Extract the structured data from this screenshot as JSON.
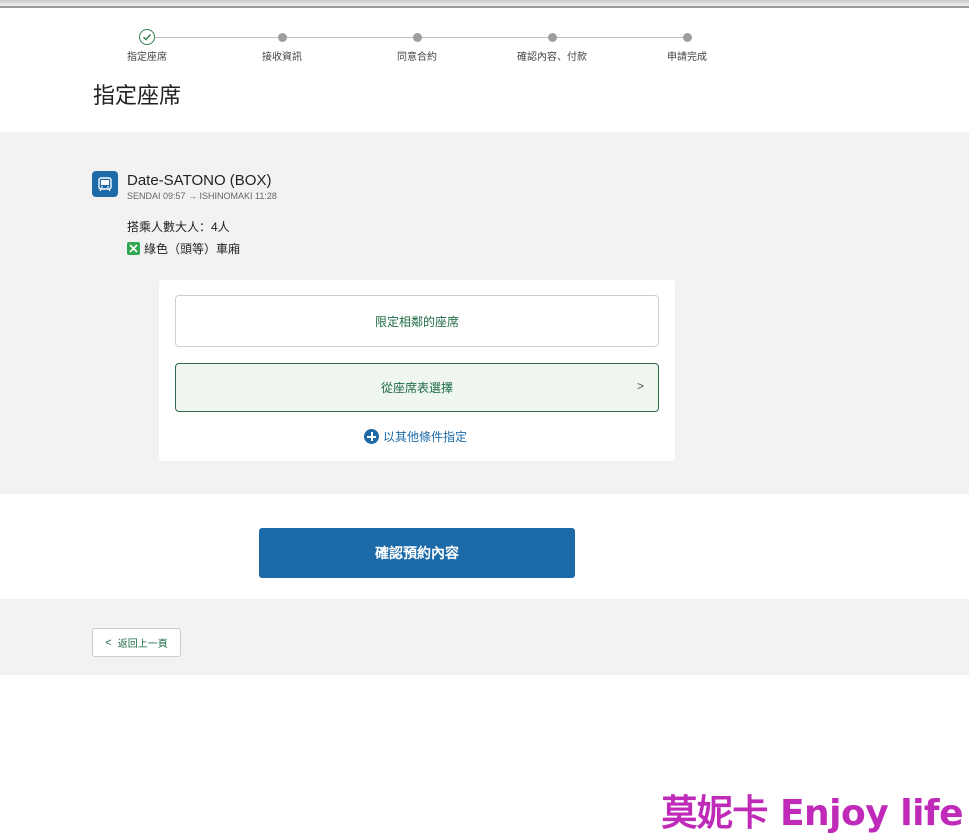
{
  "steps": [
    {
      "label": "指定座席",
      "state": "done"
    },
    {
      "label": "接收資訊",
      "state": "pending"
    },
    {
      "label": "同意合約",
      "state": "pending"
    },
    {
      "label": "確認內容、付款",
      "state": "pending"
    },
    {
      "label": "申請完成",
      "state": "pending"
    }
  ],
  "page": {
    "title": "指定座席"
  },
  "train": {
    "icon": "train-icon",
    "name": "Date-SATONO (BOX)",
    "route": "SENDAI 09:57 → ISHINOMAKI 11:28",
    "passengers": "搭乘人數大人：4人",
    "car": "綠色（頭等）車廂",
    "car_badge": "green-car-icon"
  },
  "options": {
    "adjacent": "限定相鄰的座席",
    "seat_map": "從座席表選擇",
    "more": "以其他條件指定"
  },
  "confirm": {
    "label": "確認預約內容"
  },
  "back": {
    "label": "返回上一頁"
  },
  "watermark": "莫妮卡 Enjoy life",
  "colors": {
    "primary": "#1c6aa8",
    "accent_green": "#1e6b45",
    "green_car": "#2fa84f",
    "watermark": "#c02ab8"
  }
}
